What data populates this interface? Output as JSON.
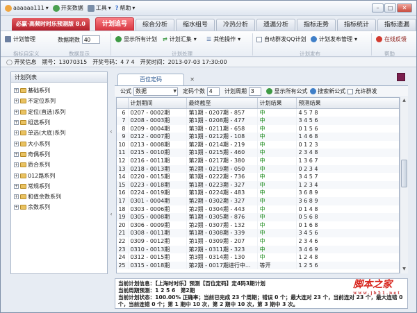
{
  "titlebar": {
    "user": "aaaaaa111",
    "open_data": "开奖数据",
    "tools": "工具",
    "help": "帮助"
  },
  "brand": "必赢·高频时时乐预测版 8.0",
  "tabs": [
    "计划追号",
    "综合分析",
    "缩水组号",
    "冷热分析",
    "遗漏分析",
    "指标走势",
    "指标统计",
    "指标遗漏"
  ],
  "ribbon": {
    "plan_manage": "计划管理",
    "periods_label": "数据期数",
    "periods_value": "40",
    "show_all_plans": "显示所有计划",
    "plan_combine": "计划汇集",
    "other_ops": "其他操作",
    "auto_qq": "自动群发QQ计划",
    "plan_publish": "计划发布管理",
    "online_feedback": "在线反馈",
    "grp_custom": "指标自定义",
    "grp_data": "数据显示",
    "grp_plan": "计划处理",
    "grp_publish": "计划发布",
    "grp_help": "帮助"
  },
  "infobar": {
    "label": "开奖信息",
    "period": "期号：13070315",
    "number": "开奖号码：4 7 4",
    "time": "开奖时间：2013-07-03 17:30:00"
  },
  "sidebar": {
    "title": "计划列表",
    "items": [
      "基础系列",
      "不定位系列",
      "定位(直选)系列",
      "组选系列",
      "单选(大底)系列",
      "大小系列",
      "奇偶系列",
      "质合系列",
      "012路系列",
      "常规系列",
      "和值余数系列",
      "余数系列"
    ]
  },
  "doc_tab": "百位定码",
  "toolbar2": {
    "formula_label": "公式",
    "formula_value": "数据",
    "count_label": "定码个数",
    "count_value": "4",
    "cycle_label": "计划周期",
    "cycle_value": "3",
    "show_all": "显示所有公式",
    "search_new": "搜索新公式",
    "allow_send": "允许群发"
  },
  "grid": {
    "headers": [
      "",
      "计划期间",
      "最终截至",
      "计划结果",
      "预测结果"
    ],
    "rows": [
      [
        "6",
        "0207 - 0002期",
        "第1期 - 0207期 - 857",
        "中",
        "4 5 7 8"
      ],
      [
        "7",
        "0208 - 0003期",
        "第1期 - 0208期 - 477",
        "中",
        "3 4 5 6"
      ],
      [
        "8",
        "0209 - 0004期",
        "第3期 - 0211期 - 658",
        "中",
        "0 1 5 6"
      ],
      [
        "9",
        "0212 - 0007期",
        "第1期 - 0212期 - 108",
        "中",
        "1 4 6 8"
      ],
      [
        "10",
        "0213 - 0008期",
        "第2期 - 0214期 - 219",
        "中",
        "0 1 2 3"
      ],
      [
        "11",
        "0215 - 0010期",
        "第1期 - 0215期 - 460",
        "中",
        "2 3 4 8"
      ],
      [
        "12",
        "0216 - 0011期",
        "第2期 - 0217期 - 380",
        "中",
        "1 3 6 7"
      ],
      [
        "13",
        "0218 - 0013期",
        "第2期 - 0219期 - 050",
        "中",
        "0 2 3 4"
      ],
      [
        "14",
        "0220 - 0015期",
        "第3期 - 0222期 - 736",
        "中",
        "3 4 5 7"
      ],
      [
        "15",
        "0223 - 0018期",
        "第1期 - 0223期 - 327",
        "中",
        "1 2 3 4"
      ],
      [
        "16",
        "0224 - 0019期",
        "第1期 - 0224期 - 483",
        "中",
        "3 6 8 9"
      ],
      [
        "17",
        "0301 - 0004期",
        "第2期 - 0302期 - 327",
        "中",
        "3 6 8 9"
      ],
      [
        "18",
        "0303 - 0006期",
        "第2期 - 0304期 - 443",
        "中",
        "0 1 4 8"
      ],
      [
        "19",
        "0305 - 0008期",
        "第1期 - 0305期 - 876",
        "中",
        "0 5 6 8"
      ],
      [
        "20",
        "0306 - 0009期",
        "第2期 - 0307期 - 132",
        "中",
        "0 1 6 8"
      ],
      [
        "21",
        "0308 - 0011期",
        "第1期 - 0308期 - 339",
        "中",
        "3 4 5 6"
      ],
      [
        "22",
        "0309 - 0012期",
        "第1期 - 0309期 - 207",
        "中",
        "2 3 4 6"
      ],
      [
        "23",
        "0310 - 0013期",
        "第2期 - 0311期 - 323",
        "中",
        "3 4 6 9"
      ],
      [
        "24",
        "0312 - 0015期",
        "第3期 - 0314期 - 130",
        "中",
        "1 2 4 8"
      ],
      [
        "25",
        "0315 - 0018期",
        "第2期 - 0017期进行中...",
        "等开",
        "1 2 5 6"
      ]
    ]
  },
  "status": {
    "line1": "当前计划信息：【上海时时乐】预测【百位定码】定4码3期计划",
    "line2": "当前周期预测：1 2 5 6　第2期",
    "line3": "当前计划状态：100.00% 正确率；当前已完成 23 个周期；错误 0 个；最大连对 23 个，当前连对 23 个，最大连错 0 个，当前连错 0 个；第 1 期中 10 次，第 2 期中 10 次，第 3 期中 3 次。"
  },
  "watermark": {
    "main": "脚本之家",
    "sub": "www.jb51.net"
  },
  "colors": {
    "accent": "#d6343f",
    "hit": "#1b8a1b",
    "watermark": "#d8261e"
  }
}
